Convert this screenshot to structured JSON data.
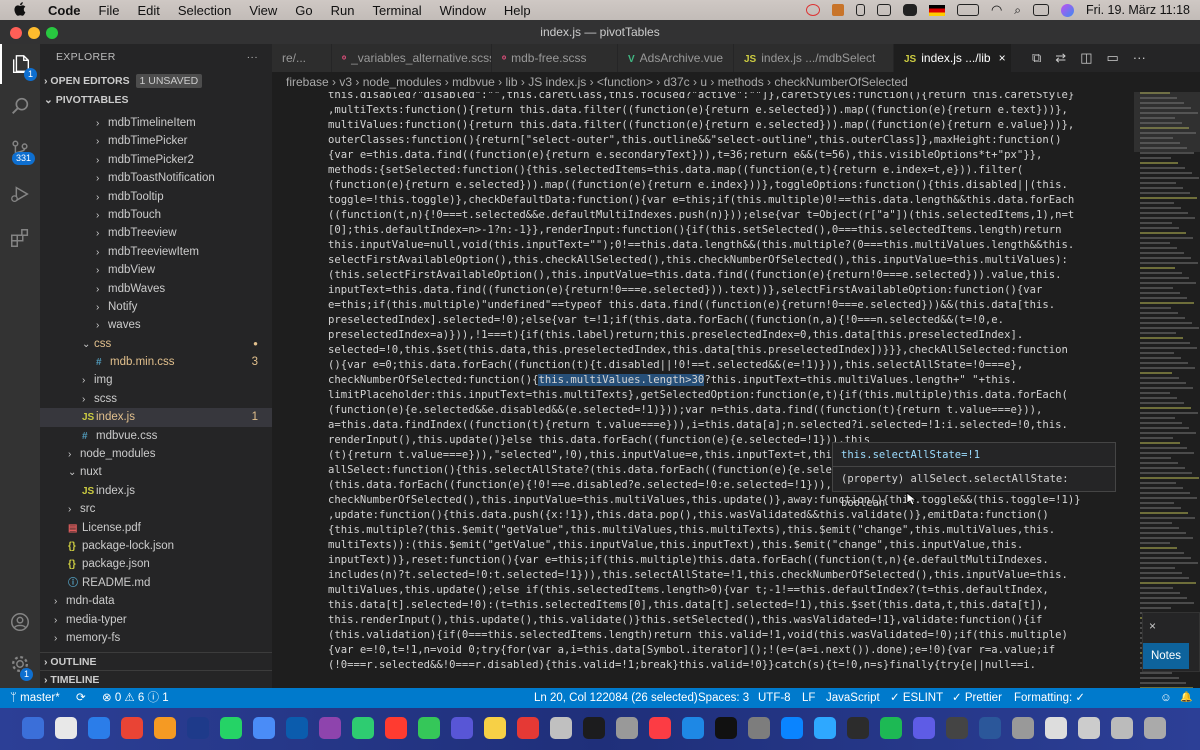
{
  "menubar": {
    "apple": "",
    "app": "Code",
    "items": [
      "File",
      "Edit",
      "Selection",
      "View",
      "Go",
      "Run",
      "Terminal",
      "Window",
      "Help"
    ],
    "clock": "Fri. 19. März  11:18"
  },
  "window": {
    "title": "index.js — pivotTables"
  },
  "activity": {
    "badge_git": "331",
    "badge_explorer": "1",
    "badge_settings": "1"
  },
  "explorer": {
    "header": "EXPLORER",
    "more": "···",
    "open_editors": "OPEN EDITORS",
    "unsaved": "1 UNSAVED",
    "project": "PIVOTTABLES",
    "outline": "OUTLINE",
    "timeline": "TIMELINE",
    "rows": [
      {
        "name": "mdbTimelineItem",
        "indent": 3,
        "kind": "folder"
      },
      {
        "name": "mdbTimePicker",
        "indent": 3,
        "kind": "folder"
      },
      {
        "name": "mdbTimePicker2",
        "indent": 3,
        "kind": "folder"
      },
      {
        "name": "mdbToastNotification",
        "indent": 3,
        "kind": "folder"
      },
      {
        "name": "mdbTooltip",
        "indent": 3,
        "kind": "folder"
      },
      {
        "name": "mdbTouch",
        "indent": 3,
        "kind": "folder"
      },
      {
        "name": "mdbTreeview",
        "indent": 3,
        "kind": "folder"
      },
      {
        "name": "mdbTreeviewItem",
        "indent": 3,
        "kind": "folder"
      },
      {
        "name": "mdbView",
        "indent": 3,
        "kind": "folder"
      },
      {
        "name": "mdbWaves",
        "indent": 3,
        "kind": "folder"
      },
      {
        "name": "Notify",
        "indent": 3,
        "kind": "folder"
      },
      {
        "name": "waves",
        "indent": 3,
        "kind": "folder"
      },
      {
        "name": "css",
        "indent": 2,
        "kind": "open",
        "color": "#e2c08d"
      },
      {
        "name": "mdb.min.css",
        "indent": 3,
        "kind": "css",
        "color": "#e2c08d",
        "count": "3"
      },
      {
        "name": "img",
        "indent": 2,
        "kind": "folder"
      },
      {
        "name": "scss",
        "indent": 2,
        "kind": "folder"
      },
      {
        "name": "index.js",
        "indent": 2,
        "kind": "js",
        "color": "#e2c08d",
        "count": "1",
        "selected": true
      },
      {
        "name": "mdbvue.css",
        "indent": 2,
        "kind": "css"
      },
      {
        "name": "node_modules",
        "indent": 1,
        "kind": "folder"
      },
      {
        "name": "nuxt",
        "indent": 1,
        "kind": "open"
      },
      {
        "name": "index.js",
        "indent": 2,
        "kind": "js"
      },
      {
        "name": "src",
        "indent": 1,
        "kind": "folder"
      },
      {
        "name": "License.pdf",
        "indent": 1,
        "kind": "pdf"
      },
      {
        "name": "package-lock.json",
        "indent": 1,
        "kind": "json"
      },
      {
        "name": "package.json",
        "indent": 1,
        "kind": "json"
      },
      {
        "name": "README.md",
        "indent": 1,
        "kind": "md"
      },
      {
        "name": "mdn-data",
        "indent": 0,
        "kind": "folder"
      },
      {
        "name": "media-typer",
        "indent": 0,
        "kind": "folder"
      },
      {
        "name": "memory-fs",
        "indent": 0,
        "kind": "folder"
      }
    ]
  },
  "tabs": [
    {
      "label": "re/...",
      "icon": ""
    },
    {
      "label": "_variables_alternative.scss",
      "icon": "ᵒ"
    },
    {
      "label": "mdb-free.scss",
      "icon": "ᵒ"
    },
    {
      "label": "AdsArchive.vue",
      "icon": "V"
    },
    {
      "label": "index.js  .../mdbSelect",
      "icon": "JS"
    },
    {
      "label": "index.js  .../lib",
      "icon": "JS",
      "active": true,
      "close": "×"
    }
  ],
  "breadcrumb": [
    "firebase",
    "v3",
    "node_modules",
    "mdbvue",
    "lib",
    "JS index.js",
    "<function>",
    "d37c",
    "u",
    "methods",
    "checkNumberOfSelected"
  ],
  "code_lines": [
    "this.disabled?\"disabled\":\"\",this.caretClass,this.focused?\"active\":\"\"]},caretStyles:function(){return this.caretStyle}",
    ",multiTexts:function(){return this.data.filter((function(e){return e.selected})).map((function(e){return e.text}))},",
    "multiValues:function(){return this.data.filter((function(e){return e.selected})).map((function(e){return e.value}))},",
    "outerClasses:function(){return[\"select-outer\",this.outline&&\"select-outline\",this.outerClass]},maxHeight:function()",
    "{var e=this.data.find((function(e){return e.secondaryText})),t=36;return e&&(t=56),this.visibleOptions*t+\"px\"}},",
    "methods:{setSelected:function(){this.selectedItems=this.data.map((function(e,t){return e.index=t,e})).filter(",
    "(function(e){return e.selected})).map((function(e){return e.index}))},toggleOptions:function(){this.disabled||(this.",
    "toggle=!this.toggle)},checkDefaultData:function(){var e=this;if(this.multiple)0!==this.data.length&&this.data.forEach",
    "((function(t,n){!0===t.selected&&e.defaultMultiIndexes.push(n)}));else{var t=Object(r[\"a\"])(this.selectedItems,1),n=t",
    "[0];this.defaultIndex=n>-1?n:-1}},renderInput:function(){if(this.setSelected(),0===this.selectedItems.length)return",
    "this.inputValue=null,void(this.inputText=\"\");0!==this.data.length&&(this.multiple?(0===this.multiValues.length&&this.",
    "selectFirstAvailableOption(),this.checkAllSelected(),this.checkNumberOfSelected(),this.inputValue=this.multiValues):",
    "(this.selectFirstAvailableOption(),this.inputValue=this.data.find((function(e){return!0===e.selected})).value,this.",
    "inputText=this.data.find((function(e){return!0===e.selected})).text))},selectFirstAvailableOption:function(){var",
    "e=this;if(this.multiple)\"undefined\"==typeof this.data.find((function(e){return!0===e.selected}))&&(this.data[this.",
    "preselectedIndex].selected=!0);else{var t=!1;if(this.data.forEach((function(n,a){!0===n.selected&&(t=!0,e.",
    "preselectedIndex=a)})),!1===t){if(this.label)return;this.preselectedIndex=0,this.data[this.preselectedIndex].",
    "selected=!0,this.$set(this.data,this.preselectedIndex,this.data[this.preselectedIndex])}}},checkAllSelected:function",
    "(){var e=0;this.data.forEach((function(t){t.disabled||!0!==t.selected&&(e=!1)})),this.selectAllState=!0===e},",
    "checkNumberOfSelected:function(){this.multiValues.length>30?this.inputText=this.multiValues.length+\" \"+this.",
    "limitPlaceholder:this.inputText=this.multiTexts},getSelectedOption:function(e,t){if(this.multiple)this.data.forEach(",
    "(function(e){e.selected&&e.disabled&&(e.selected=!1)}));var n=this.data.find((function(t){return t.value===e})),",
    "a=this.data.findIndex((function(t){return t.value===e})),i=this.data[a];n.selected?i.selected=!1:i.selected=!0,this.",
    "renderInput(),this.update()}else this.data.forEach((function(e){e.selected=!1})),this",
    "(t){return t.value===e})),\"selected\",!0),this.inputValue=e,this.inputText=t,this.upd",
    "allSelect:function(){this.selectAllState?(this.data.forEach((function(e){e.selected=",
    "(this.data.forEach((function(e){!0!==e.disabled?e.selected=!0:e.selected=!1})),this.selectAllState=!0),this.",
    "checkNumberOfSelected(),this.inputValue=this.multiValues,this.update()},away:function(){this.toggle&&(this.toggle=!1)}",
    ",update:function(){this.data.push({x:!1}),this.data.pop(),this.wasValidated&&this.validate()},emitData:function()",
    "{this.multiple?(this.$emit(\"getValue\",this.multiValues,this.multiTexts),this.$emit(\"change\",this.multiValues,this.",
    "multiTexts)):(this.$emit(\"getValue\",this.inputValue,this.inputText),this.$emit(\"change\",this.inputValue,this.",
    "inputText))},reset:function(){var e=this;if(this.multiple)this.data.forEach((function(t,n){e.defaultMultiIndexes.",
    "includes(n)?t.selected=!0:t.selected=!1})),this.selectAllState=!1,this.checkNumberOfSelected(),this.inputValue=this.",
    "multiValues,this.update();else if(this.selectedItems.length>0){var t;-1!==this.defaultIndex?(t=this.defaultIndex,",
    "this.data[t].selected=!0):(t=this.selectedItems[0],this.data[t].selected=!1),this.$set(this.data,t,this.data[t]),",
    "this.renderInput(),this.update(),this.validate()}this.setSelected(),this.wasValidated=!1},validate:function(){if",
    "(this.validation){if(0===this.selectedItems.length)return this.valid=!1,void(this.wasValidated=!0);if(this.multiple)",
    "{var e=!0,t=!1,n=void 0;try{for(var a,i=this.data[Symbol.iterator]();!(e=(a=i.next()).done);e=!0){var r=a.value;if",
    "(!0===r.selected&&!0===r.disabled){this.valid=!1;break}this.valid=!0}}catch(s){t=!0,n=s}finally{try{e||null==i."
  ],
  "hover": {
    "expr": "this.selectAllState=!1",
    "detail": "(property) allSelect.selectAllState: boolean"
  },
  "notification": {
    "button": "Notes"
  },
  "statusbar": {
    "branch": "master*",
    "sync": "⟳",
    "problems": "⊗ 0  ⚠ 6  ⓘ 1",
    "position": "Ln 20, Col 122084 (26 selected)",
    "spaces": "Spaces: 3",
    "encoding": "UTF-8",
    "eol": "LF",
    "language": "JavaScript",
    "eslint": "✓ ESLINT",
    "prettier": "✓ Prettier",
    "formatting": "Formatting: ✓",
    "feedback": "☺",
    "bell": "🔔"
  },
  "dock_colors": [
    "#3b6fd9",
    "#e8e8e8",
    "#2b7de9",
    "#e94435",
    "#f59a23",
    "#1e3a8a",
    "#25d366",
    "#4a8cf7",
    "#0b5cad",
    "#8e44ad",
    "#2ecc71",
    "#ff3b30",
    "#35c759",
    "#5856d6",
    "#f7d046",
    "#e53935",
    "#c0c0c0",
    "#1c1c1e",
    "#999",
    "#fc3c44",
    "#1e88e5",
    "#111",
    "#7d7d7d",
    "#0a84ff",
    "#2ea8ff",
    "#2c2c2c",
    "#1db954",
    "#5e5ce6",
    "#444",
    "#2b579a",
    "#999",
    "#ddd",
    "#ccc",
    "#bbb",
    "#aaa"
  ],
  "colors": {
    "accent": "#007acc",
    "selection": "#264f78",
    "function": "#dcdcaa"
  }
}
